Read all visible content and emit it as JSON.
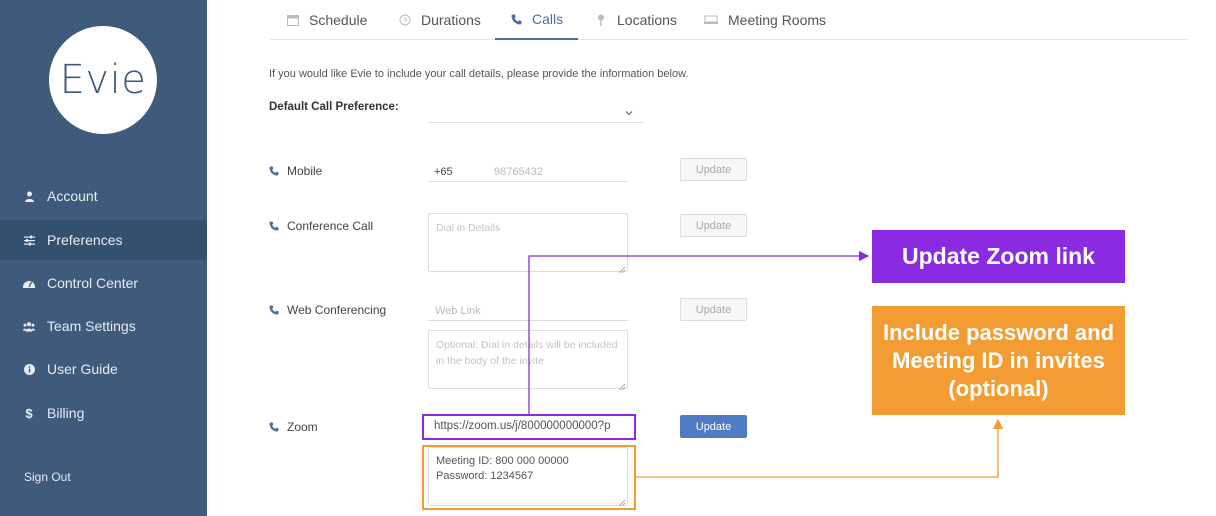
{
  "sidebar": {
    "logo": "Evie",
    "items": [
      {
        "label": "Account",
        "icon": "user-icon"
      },
      {
        "label": "Preferences",
        "icon": "sliders-icon",
        "active": true
      },
      {
        "label": "Control Center",
        "icon": "dashboard-icon"
      },
      {
        "label": "Team Settings",
        "icon": "team-icon"
      },
      {
        "label": "User Guide",
        "icon": "info-icon"
      },
      {
        "label": "Billing",
        "icon": "dollar-icon"
      }
    ],
    "sign_out": "Sign Out"
  },
  "tabs": [
    {
      "label": "Schedule",
      "icon": "calendar-icon"
    },
    {
      "label": "Durations",
      "icon": "clock-icon"
    },
    {
      "label": "Calls",
      "icon": "phone-icon",
      "active": true
    },
    {
      "label": "Locations",
      "icon": "pin-icon"
    },
    {
      "label": "Meeting Rooms",
      "icon": "room-icon"
    }
  ],
  "main": {
    "intro": "If you would like Evie to include your call details, please provide the information below.",
    "default_pref_label": "Default Call Preference:",
    "default_pref_value": "",
    "mobile": {
      "label": "Mobile",
      "code": "+65",
      "placeholder": "98765432",
      "button": "Update"
    },
    "conference": {
      "label": "Conference Call",
      "placeholder": "Dial in Details",
      "button": "Update"
    },
    "web": {
      "label": "Web Conferencing",
      "placeholder": "Web Link",
      "notes_placeholder": "Optional: Dial in details will be included in the body of the invite",
      "button": "Update"
    },
    "zoom": {
      "label": "Zoom",
      "link": "https://zoom.us/j/800000000000?p",
      "meeting_id": "Meeting ID: 800 000 00000",
      "password": "Password: 1234567",
      "button": "Update"
    }
  },
  "callouts": {
    "update_zoom": "Update Zoom link",
    "include_password": "Include password and Meeting ID in invites (optional)"
  },
  "colors": {
    "sidebar": "#3f5a7a",
    "accent": "#4f7bc2",
    "purple": "#8a2be2",
    "orange": "#f39c33"
  }
}
